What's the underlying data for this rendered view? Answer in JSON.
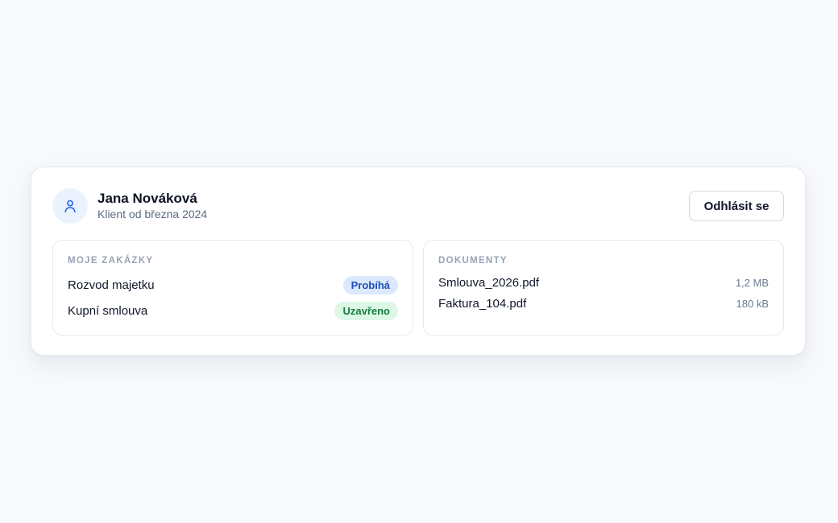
{
  "user": {
    "name": "Jana Nováková",
    "subtitle": "Klient od března 2024",
    "avatar_icon": "user-icon"
  },
  "header": {
    "logout_label": "Odhlásit se"
  },
  "orders": {
    "title": "MOJE ZAKÁZKY",
    "items": [
      {
        "name": "Rozvod majetku",
        "status": "Probíhá",
        "status_color": "#1e4fb8",
        "status_bg": "#dbe8fd"
      },
      {
        "name": "Kupní smlouva",
        "status": "Uzavřeno",
        "status_color": "#167a3e",
        "status_bg": "#dcf7e6"
      }
    ]
  },
  "documents": {
    "title": "DOKUMENTY",
    "items": [
      {
        "name": "Smlouva_2026.pdf",
        "size": "1,2 MB"
      },
      {
        "name": "Faktura_104.pdf",
        "size": "180 kB"
      }
    ]
  },
  "colors": {
    "page_bg": "#f7f9fc",
    "accent": "#2563eb",
    "avatar_bg": "#eaf2fe"
  }
}
